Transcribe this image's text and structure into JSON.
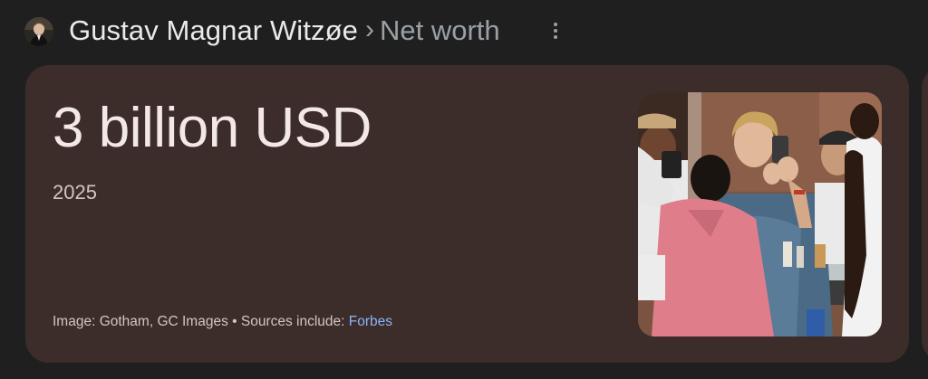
{
  "header": {
    "entity_name": "Gustav Magnar Witzøe",
    "separator": "›",
    "topic": "Net worth",
    "avatar_icon": "person-avatar-icon",
    "more_icon": "more-vertical-icon"
  },
  "card": {
    "value": "3 billion USD",
    "year": "2025",
    "image_credit": "Image: Gotham, GC Images",
    "bullet": " • ",
    "sources_label": "Sources include: ",
    "source_link": "Forbes"
  },
  "colors": {
    "page_background": "#1f1f1f",
    "card_background": "#3c2d2b",
    "link": "#8ab4f8",
    "primary_text": "#e8eaed",
    "secondary_text": "#9aa0a6"
  }
}
